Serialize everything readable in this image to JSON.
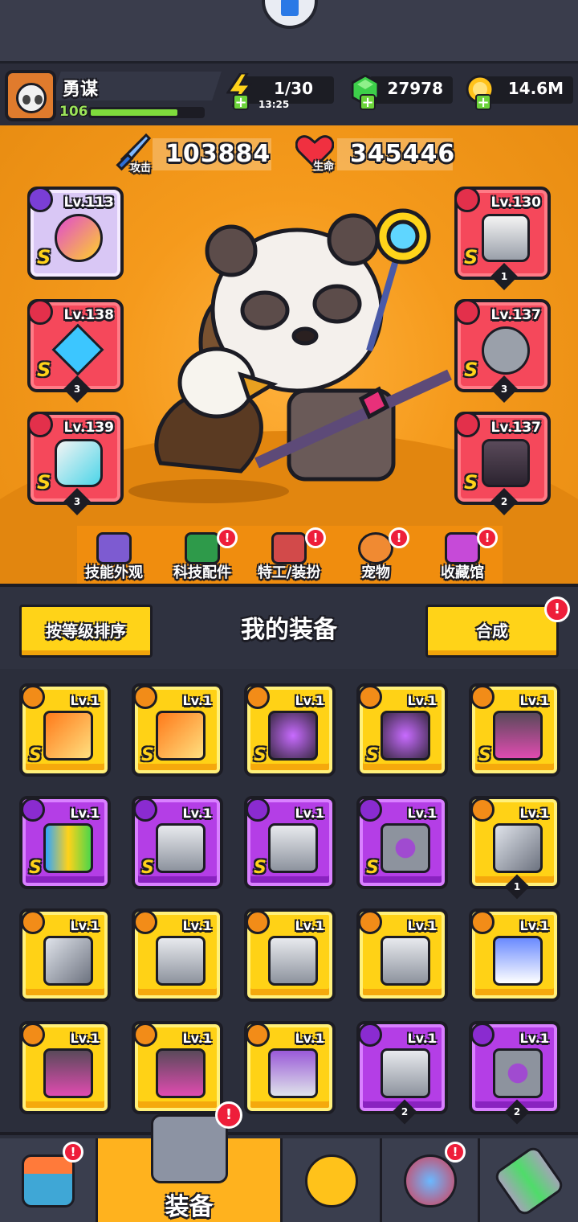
{
  "player": {
    "name": "勇谋",
    "level": "106",
    "xp_fraction": 0.78
  },
  "resources": {
    "energy": "1/30",
    "energy_timer": "13:25",
    "gems": "27978",
    "coins": "14.6M"
  },
  "stats": {
    "attack_label": "攻击",
    "attack_value": "103884",
    "hp_label": "生命",
    "hp_value": "345446"
  },
  "equipped": {
    "left": [
      {
        "lv": "Lv.113",
        "grade": "S",
        "rarity": "purple",
        "icon": "staff-icon"
      },
      {
        "lv": "Lv.138",
        "grade": "S",
        "rarity": "red",
        "stars": "3",
        "icon": "necklace-icon"
      },
      {
        "lv": "Lv.139",
        "grade": "S",
        "rarity": "red",
        "stars": "3",
        "icon": "gauntlet-icon"
      }
    ],
    "right": [
      {
        "lv": "Lv.130",
        "grade": "S",
        "rarity": "red",
        "stars": "1",
        "icon": "armor-icon"
      },
      {
        "lv": "Lv.137",
        "grade": "S",
        "rarity": "red",
        "stars": "3",
        "icon": "belt-icon"
      },
      {
        "lv": "Lv.137",
        "grade": "S",
        "rarity": "red",
        "stars": "2",
        "icon": "boots-icon"
      }
    ]
  },
  "submenu": [
    {
      "label": "技能外观",
      "alert": false,
      "color": "#7d5bd1"
    },
    {
      "label": "科技配件",
      "alert": true,
      "color": "#2e9a4a"
    },
    {
      "label": "特工/装扮",
      "alert": true,
      "color": "#d24a4a"
    },
    {
      "label": "宠物",
      "alert": true,
      "color": "#f08a32"
    },
    {
      "label": "收藏馆",
      "alert": true,
      "color": "#c64ad8"
    }
  ],
  "equip_header": {
    "sort_label": "按等级排序",
    "title": "我的装备",
    "merge_label": "合成"
  },
  "inventory": [
    {
      "lv": "Lv.1",
      "rarity": "yellow",
      "grade": "S",
      "icon": "sword-icon"
    },
    {
      "lv": "Lv.1",
      "rarity": "yellow",
      "grade": "S",
      "icon": "sword-icon"
    },
    {
      "lv": "Lv.1",
      "rarity": "yellow",
      "grade": "S",
      "icon": "drill-staff-icon"
    },
    {
      "lv": "Lv.1",
      "rarity": "yellow",
      "grade": "S",
      "icon": "drill-staff-icon"
    },
    {
      "lv": "Lv.1",
      "rarity": "yellow",
      "grade": "S",
      "icon": "boots-icon"
    },
    {
      "lv": "Lv.1",
      "rarity": "purple",
      "grade": "S",
      "icon": "water-gun-icon"
    },
    {
      "lv": "Lv.1",
      "rarity": "purple",
      "grade": "S",
      "icon": "armor-icon"
    },
    {
      "lv": "Lv.1",
      "rarity": "purple",
      "grade": "S",
      "icon": "armor-icon"
    },
    {
      "lv": "Lv.1",
      "rarity": "purple",
      "grade": "S",
      "icon": "belt-icon"
    },
    {
      "lv": "Lv.1",
      "rarity": "yellow",
      "grade": "",
      "stars": "1",
      "icon": "kunai-icon"
    },
    {
      "lv": "Lv.1",
      "rarity": "yellow",
      "grade": "",
      "icon": "kunai-icon"
    },
    {
      "lv": "Lv.1",
      "rarity": "yellow",
      "grade": "",
      "icon": "armor-icon"
    },
    {
      "lv": "Lv.1",
      "rarity": "yellow",
      "grade": "",
      "icon": "armor-icon"
    },
    {
      "lv": "Lv.1",
      "rarity": "yellow",
      "grade": "",
      "icon": "armor-icon"
    },
    {
      "lv": "Lv.1",
      "rarity": "yellow",
      "grade": "",
      "icon": "claw-glove-icon"
    },
    {
      "lv": "Lv.1",
      "rarity": "yellow",
      "grade": "",
      "icon": "boots-icon"
    },
    {
      "lv": "Lv.1",
      "rarity": "yellow",
      "grade": "",
      "icon": "boots-icon"
    },
    {
      "lv": "Lv.1",
      "rarity": "yellow",
      "grade": "",
      "icon": "sneaker-icon"
    },
    {
      "lv": "Lv.1",
      "rarity": "purple",
      "grade": "",
      "stars": "2",
      "icon": "armor-icon"
    },
    {
      "lv": "Lv.1",
      "rarity": "purple",
      "grade": "",
      "stars": "2",
      "icon": "belt-icon"
    }
  ],
  "bottom_nav": {
    "equip_label": "装备"
  }
}
